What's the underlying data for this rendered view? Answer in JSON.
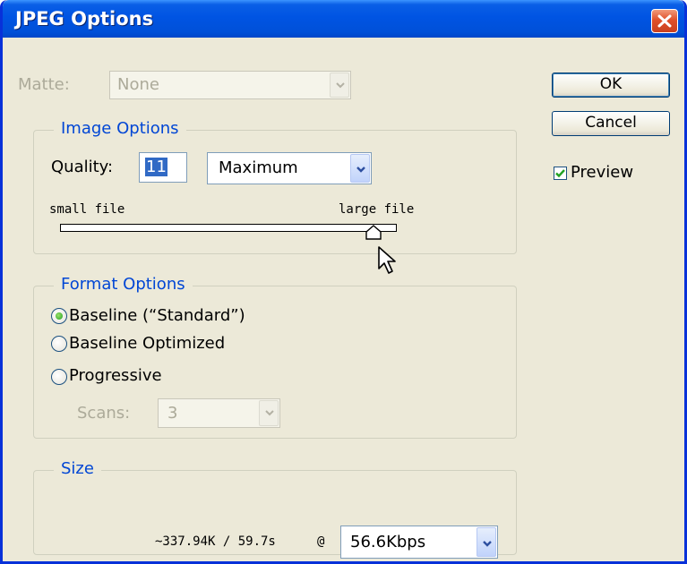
{
  "window": {
    "title": "JPEG Options"
  },
  "matte": {
    "label": "Matte:",
    "value": "None"
  },
  "image_options": {
    "title": "Image Options",
    "quality_label": "Quality:",
    "quality_value": "11",
    "quality_preset": "Maximum",
    "slider_min_label": "small file",
    "slider_max_label": "large file",
    "slider_level": 0.93
  },
  "format_options": {
    "title": "Format Options",
    "options": [
      {
        "label": "Baseline (“Standard”)",
        "checked": true
      },
      {
        "label": "Baseline Optimized",
        "checked": false
      },
      {
        "label": "Progressive",
        "checked": false
      }
    ],
    "scans_label": "Scans:",
    "scans_value": "3"
  },
  "size": {
    "title": "Size",
    "estimate": "~337.94K / 59.7s",
    "at": "@",
    "speed": "56.6Kbps"
  },
  "buttons": {
    "ok": "OK",
    "cancel": "Cancel"
  },
  "preview": {
    "label": "Preview",
    "checked": true
  },
  "colors": {
    "titlebar": "#0054e3",
    "dialog_bg": "#ece9d8",
    "group_title": "#0046d5"
  }
}
